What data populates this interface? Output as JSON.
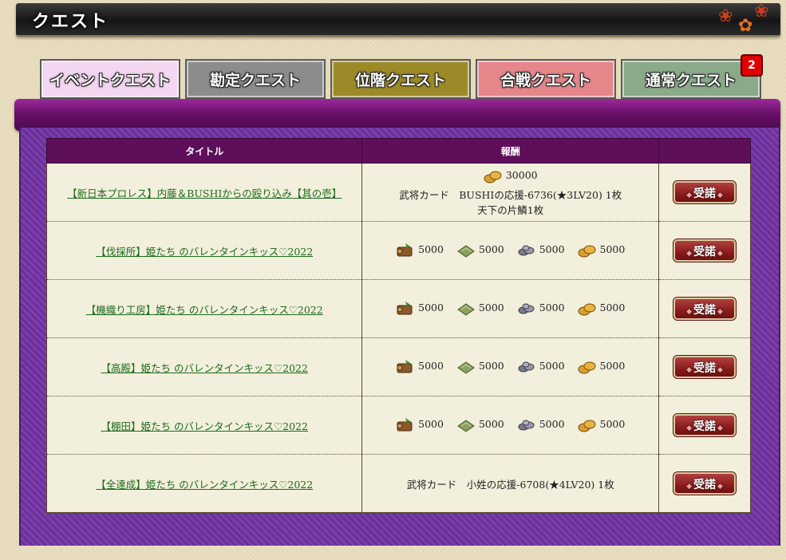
{
  "header": {
    "title": "クエスト"
  },
  "tabs": [
    {
      "label": "イベントクエスト",
      "color": "#f3d6ef",
      "active": true
    },
    {
      "label": "勘定クエスト",
      "color": "#8c8c8c"
    },
    {
      "label": "位階クエスト",
      "color": "#9c8a28"
    },
    {
      "label": "合戦クエスト",
      "color": "#e4868a"
    },
    {
      "label": "通常クエスト",
      "color": "#8aaa8a"
    }
  ],
  "badge": {
    "count": "2"
  },
  "table": {
    "headers": {
      "title": "タイトル",
      "reward": "報酬",
      "action": ""
    },
    "accept_label": "受諾",
    "rows": [
      {
        "title": "【新日本プロレス】内藤＆BUSHIからの殴り込み【其の壱】",
        "gold": "30000",
        "lines": [
          "武将カード　BUSHIの応援-6736(★3LV20) 1枚",
          "天下の片鱗1枚"
        ]
      },
      {
        "title": "【伐採所】姫たち のバレンタインキッス♡2022",
        "resources": [
          "5000",
          "5000",
          "5000",
          "5000"
        ]
      },
      {
        "title": "【機織り工房】姫たち のバレンタインキッス♡2022",
        "resources": [
          "5000",
          "5000",
          "5000",
          "5000"
        ]
      },
      {
        "title": "【高殿】姫たち のバレンタインキッス♡2022",
        "resources": [
          "5000",
          "5000",
          "5000",
          "5000"
        ]
      },
      {
        "title": "【棚田】姫たち のバレンタインキッス♡2022",
        "resources": [
          "5000",
          "5000",
          "5000",
          "5000"
        ]
      },
      {
        "title": "【全達成】姫たち のバレンタインキッス♡2022",
        "lines": [
          "武将カード　小姓の応援-6708(★4LV20) 1枚"
        ]
      }
    ]
  },
  "icons": [
    "wood-icon",
    "cloth-icon",
    "iron-icon",
    "rice-icon",
    "gold-icon",
    "maple-leaf-icon"
  ]
}
